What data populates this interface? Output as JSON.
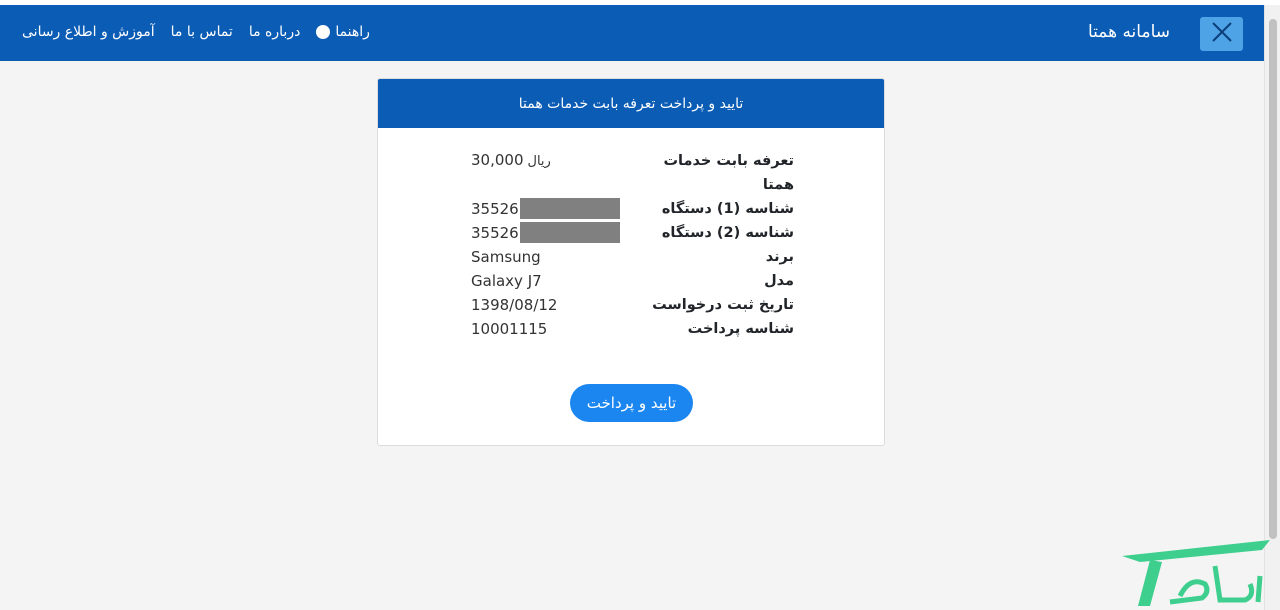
{
  "navbar": {
    "brand_title": "سامانه همتا",
    "links": [
      "آموزش و اطلاع رسانی",
      "تماس با ما",
      "درباره ما",
      "راهنما"
    ],
    "close_icon": "close-icon",
    "help_icon": "info-icon"
  },
  "card": {
    "title": "تایید و پرداخت تعرفه بابت خدمات همتا",
    "rows": [
      {
        "label": "تعرفه بابت خدمات همتا",
        "value": "30,000",
        "unit": "ریال"
      },
      {
        "label": "شناسه (1) دستگاه",
        "value": "35526"
      },
      {
        "label": "شناسه (2) دستگاه",
        "value": "35526"
      },
      {
        "label": "برند",
        "value": "Samsung"
      },
      {
        "label": "مدل",
        "value": "Galaxy J7"
      },
      {
        "label": "تاریخ ثبت درخواست",
        "value": "1398/08/12"
      },
      {
        "label": "شناسه پرداخت",
        "value": "10001115"
      }
    ],
    "button": "تایید و پرداخت"
  },
  "colors": {
    "primary": "#0b5cb5",
    "button": "#1b86ef",
    "close_button": "#4ea3e6",
    "watermark": "#3ecf8e"
  }
}
